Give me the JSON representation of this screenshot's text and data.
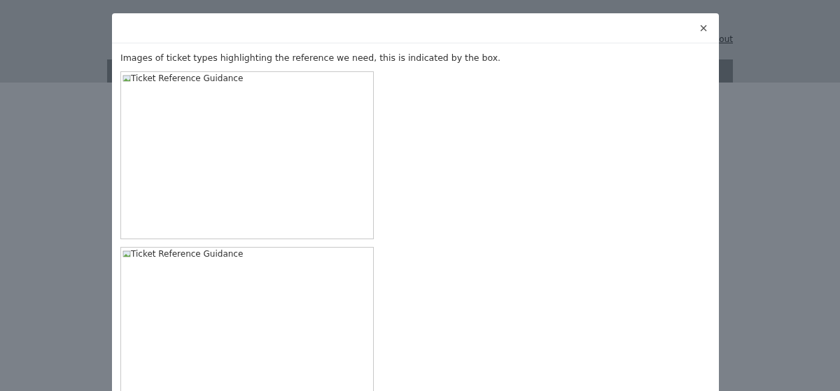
{
  "background_page": {
    "header_link": "out"
  },
  "modal": {
    "close": "×",
    "intro": "Images of ticket types highlighting the reference we need, this is indicated by the box.",
    "images": [
      {
        "alt": "Ticket Reference Guidance"
      },
      {
        "alt": "Ticket Reference Guidance"
      }
    ]
  }
}
